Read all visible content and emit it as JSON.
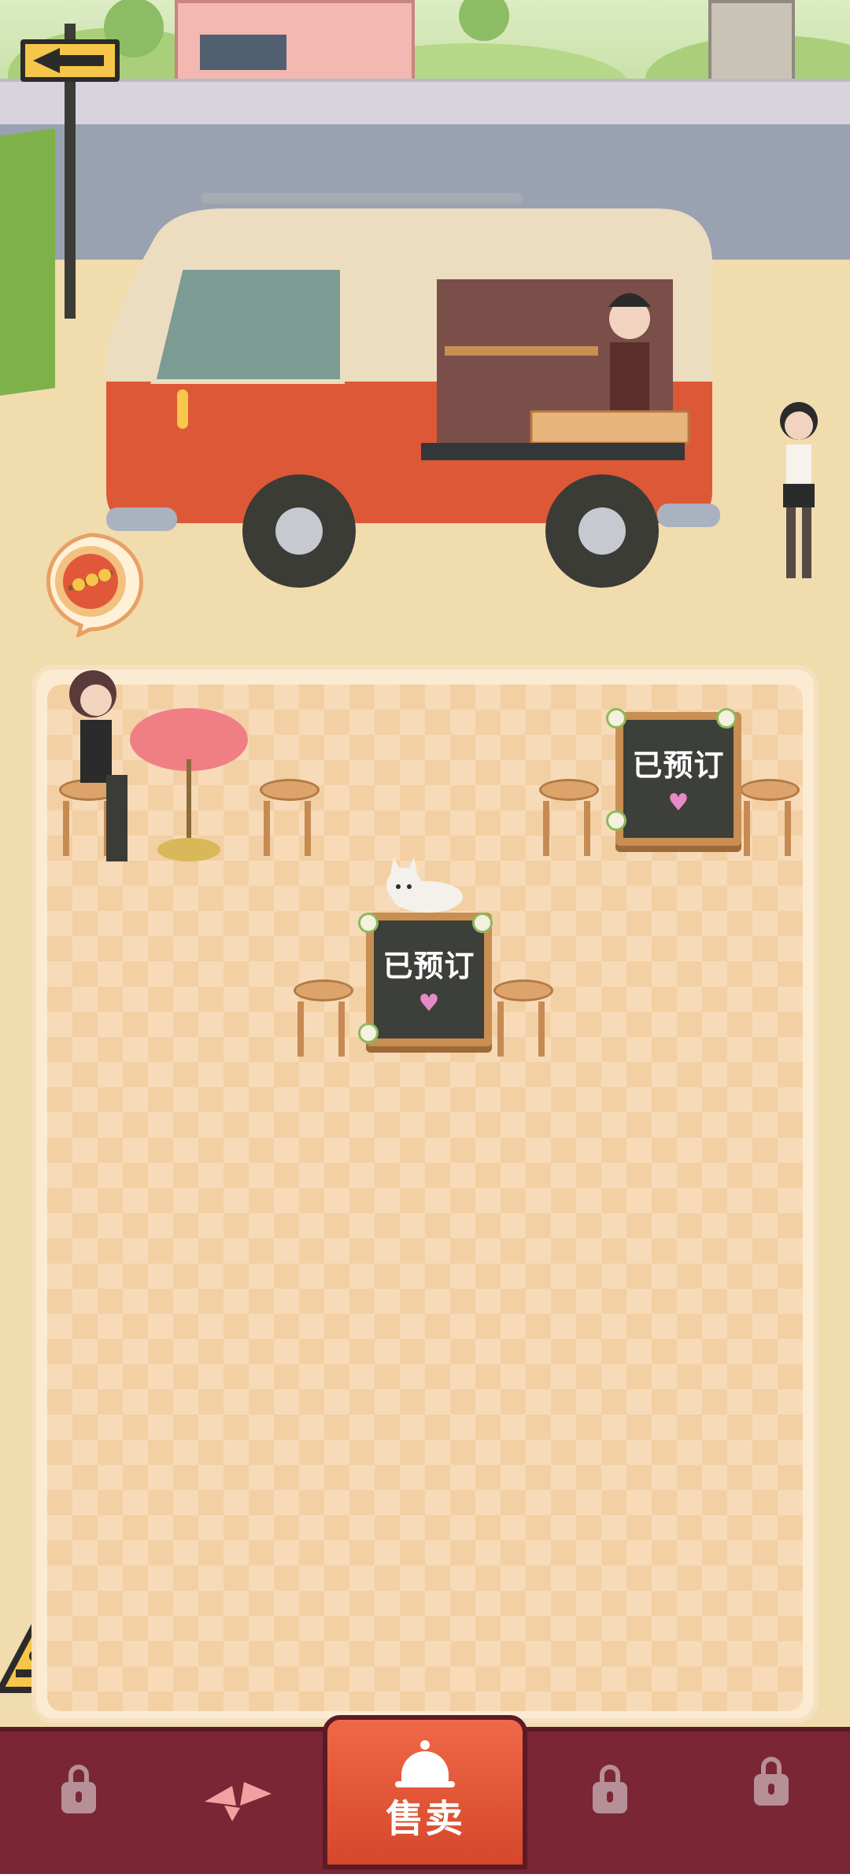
{
  "tables": [
    {
      "id": "center",
      "status": "已预订"
    },
    {
      "id": "top-right",
      "status": "已预订"
    }
  ],
  "bottom_nav": {
    "items": [
      {
        "name": "locked",
        "icon": "lock-icon"
      },
      {
        "name": "decor",
        "icon": "ribbon-icon"
      },
      {
        "name": "sell",
        "icon": "service-bell-icon",
        "label": "售卖"
      },
      {
        "name": "locked",
        "icon": "lock-icon"
      },
      {
        "name": "locked",
        "icon": "lock-icon"
      }
    ]
  },
  "order_bubble": {
    "icon": "skewer-dish-icon"
  },
  "colors": {
    "accent": "#e0573a",
    "nav_bg": "#7a2635",
    "van": "#dd5836"
  }
}
